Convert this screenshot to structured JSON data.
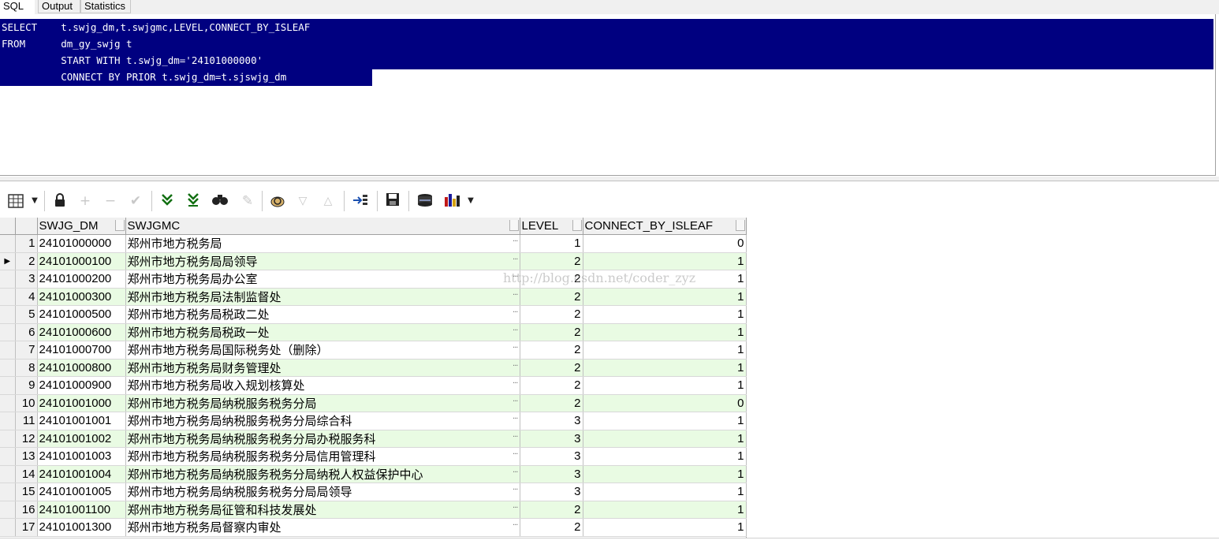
{
  "tabs": [
    "SQL",
    "Output",
    "Statistics"
  ],
  "sql_lines": [
    "SELECT    t.swjg_dm,t.swjgmc,LEVEL,CONNECT_BY_ISLEAF",
    "FROM      dm_gy_swjg t",
    "          START WITH t.swjg_dm='24101000000'",
    "          CONNECT BY PRIOR t.swjg_dm=t.sjswjg_dm"
  ],
  "toolbar": {
    "icons": [
      "grid-icon",
      "dropdown-arrow-icon",
      "lock-icon",
      "add-record-icon",
      "delete-record-icon",
      "post-edit-icon",
      "fetch-next-icon",
      "fetch-last-icon",
      "find-icon",
      "clear-icon",
      "query-by-example-icon",
      "sort-desc-icon",
      "sort-asc-icon",
      "single-record-view-icon",
      "save-icon",
      "export-icon",
      "chart-icon",
      "chart-dropdown-icon"
    ]
  },
  "grid": {
    "columns": [
      "SWJG_DM",
      "SWJGMC",
      "LEVEL",
      "CONNECT_BY_ISLEAF"
    ],
    "rows": [
      [
        "24101000000",
        "郑州市地方税务局",
        "1",
        "0"
      ],
      [
        "24101000100",
        "郑州市地方税务局局领导",
        "2",
        "1"
      ],
      [
        "24101000200",
        "郑州市地方税务局办公室",
        "2",
        "1"
      ],
      [
        "24101000300",
        "郑州市地方税务局法制监督处",
        "2",
        "1"
      ],
      [
        "24101000500",
        "郑州市地方税务局税政二处",
        "2",
        "1"
      ],
      [
        "24101000600",
        "郑州市地方税务局税政一处",
        "2",
        "1"
      ],
      [
        "24101000700",
        "郑州市地方税务局国际税务处（删除）",
        "2",
        "1"
      ],
      [
        "24101000800",
        "郑州市地方税务局财务管理处",
        "2",
        "1"
      ],
      [
        "24101000900",
        "郑州市地方税务局收入规划核算处",
        "2",
        "1"
      ],
      [
        "24101001000",
        "郑州市地方税务局纳税服务税务分局",
        "2",
        "0"
      ],
      [
        "24101001001",
        "郑州市地方税务局纳税服务税务分局综合科",
        "3",
        "1"
      ],
      [
        "24101001002",
        "郑州市地方税务局纳税服务税务分局办税服务科",
        "3",
        "1"
      ],
      [
        "24101001003",
        "郑州市地方税务局纳税服务税务分局信用管理科",
        "3",
        "1"
      ],
      [
        "24101001004",
        "郑州市地方税务局纳税服务税务分局纳税人权益保护中心",
        "3",
        "1"
      ],
      [
        "24101001005",
        "郑州市地方税务局纳税服务税务分局局领导",
        "3",
        "1"
      ],
      [
        "24101001100",
        "郑州市地方税务局征管和科技发展处",
        "2",
        "1"
      ],
      [
        "24101001300",
        "郑州市地方税务局督察内审处",
        "2",
        "1"
      ]
    ],
    "current_row": 2,
    "ellipsis": "···"
  },
  "watermark": "http://blog.csdn.net/coder_zyz"
}
